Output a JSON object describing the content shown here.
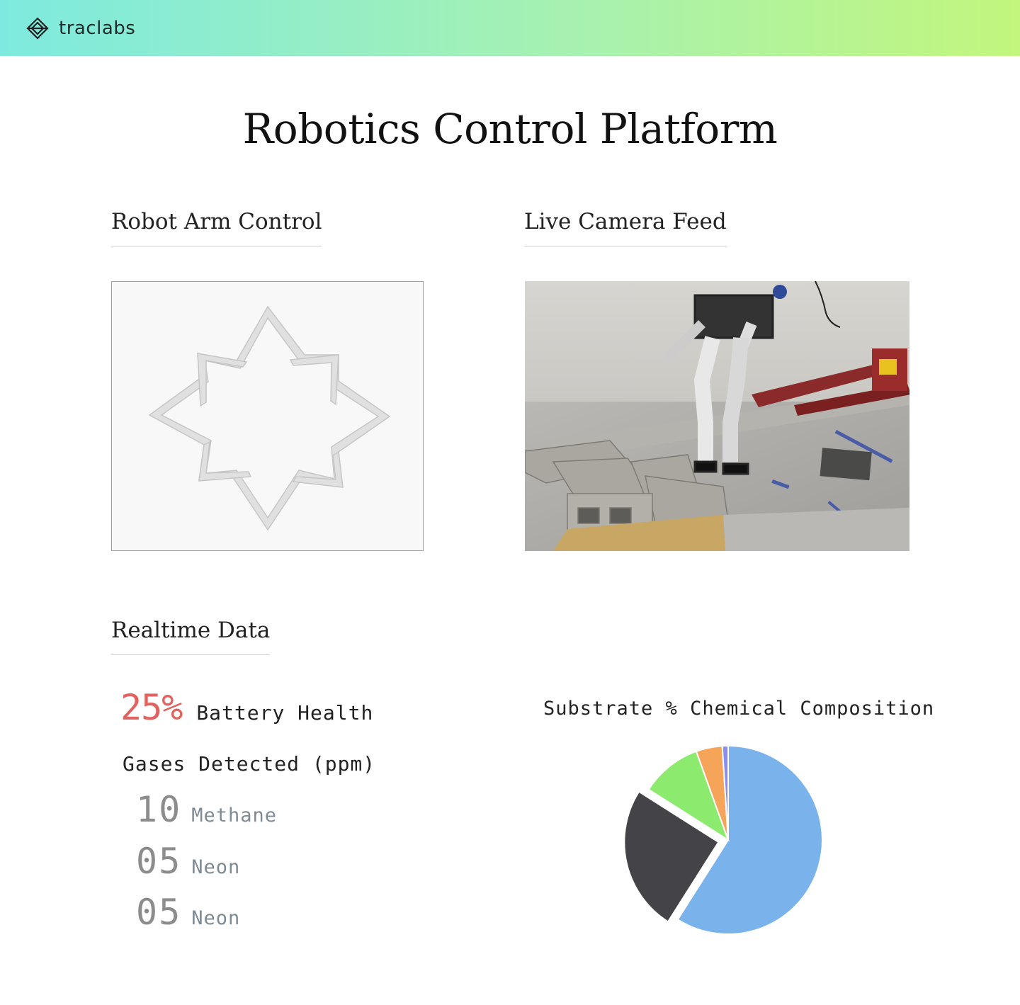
{
  "header": {
    "brand": "traclabs",
    "logo_icon": "diamond-layers-icon",
    "gradient_colors": [
      "#7eeadf",
      "#c2f67c"
    ]
  },
  "page": {
    "title": "Robotics Control Platform"
  },
  "arm_control": {
    "heading": "Robot Arm Control"
  },
  "camera": {
    "heading": "Live Camera Feed"
  },
  "realtime": {
    "heading": "Realtime Data",
    "battery": {
      "value": "25%",
      "label": "Battery Health",
      "color": "#e0635f"
    },
    "gases_title": "Gases Detected (ppm)",
    "gases": [
      {
        "value": "10",
        "name": "Methane"
      },
      {
        "value": "05",
        "name": "Neon"
      },
      {
        "value": "05",
        "name": "Neon"
      }
    ]
  },
  "composition": {
    "title": "Substrate % Chemical Composition"
  },
  "chart_data": {
    "type": "pie",
    "title": "Substrate % Chemical Composition",
    "values": [
      59,
      25,
      10.5,
      4.5,
      1
    ],
    "colors": [
      "#7ab3ec",
      "#434348",
      "#8ceb6e",
      "#f7a45b",
      "#8c8cf0"
    ],
    "exploded": [
      false,
      true,
      false,
      false,
      false
    ],
    "legend": "none"
  }
}
